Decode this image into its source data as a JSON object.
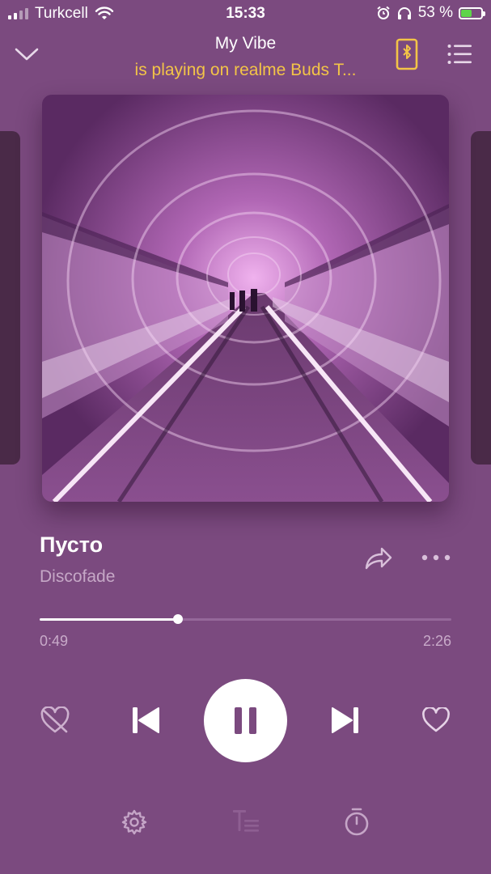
{
  "status_bar": {
    "carrier": "Turkcell",
    "time": "15:33",
    "battery_percent": "53 %",
    "battery_level": 0.53,
    "battery_color": "#5ed44a"
  },
  "header": {
    "title": "My Vibe",
    "subtitle": "is playing on realme Buds T...",
    "subtitle_color": "#f3c447"
  },
  "track": {
    "title": "Пусто",
    "artist": "Discofade"
  },
  "progress": {
    "elapsed": "0:49",
    "total": "2:26",
    "fraction": 0.335
  },
  "icons": {
    "collapse": "chevron-down-icon",
    "device": "bluetooth-phone-icon",
    "queue": "list-icon",
    "share": "share-icon",
    "more": "more-icon",
    "dislike": "dislike-heart-icon",
    "previous": "previous-icon",
    "pause": "pause-icon",
    "next": "next-icon",
    "like": "heart-icon",
    "settings": "gear-icon",
    "lyrics": "lyrics-icon",
    "timer": "timer-icon"
  },
  "colors": {
    "background": "#7b4a7f",
    "accent": "#f3c447"
  }
}
